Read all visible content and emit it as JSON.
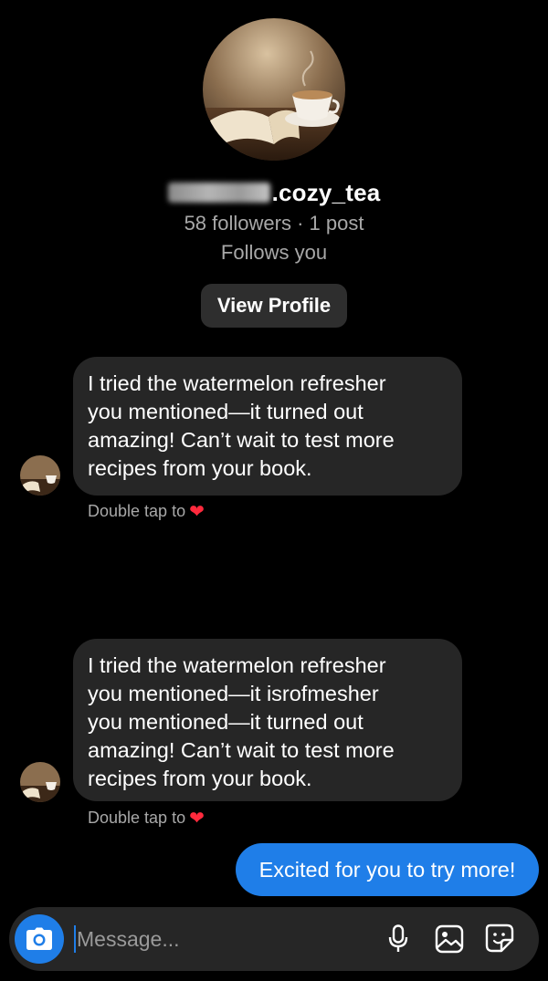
{
  "profile": {
    "username_suffix": ".cozy_tea",
    "followers_line": "58 followers · 1 post",
    "follows_you": "Follows you",
    "view_profile_label": "View Profile"
  },
  "messages": [
    {
      "text": "I tried the watermelon refresher\nyou mentioned—it turned out\namazing! Can’t wait to test more\nrecipes from your book.",
      "reaction_hint": "Double tap to"
    },
    {
      "text": "I tried the watermelon refresher\nyou mentioned—it isrofmesher\nyou mentioned—it turned out\namazing! Can’t wait to test more\nrecipes from your book.",
      "reaction_hint": "Double tap to"
    }
  ],
  "my_message": {
    "text": "Excited for you to try more!"
  },
  "composer": {
    "placeholder": "Message..."
  },
  "icons": {
    "camera": "camera-icon",
    "mic": "microphone-icon",
    "gallery": "gallery-icon",
    "sticker": "sticker-icon",
    "heart": "heart-icon"
  },
  "colors": {
    "background": "#000000",
    "bubble": "#262626",
    "accent_blue": "#1f7ee8",
    "muted_text": "#a8a8a8",
    "heart": "#ff2a3d"
  }
}
